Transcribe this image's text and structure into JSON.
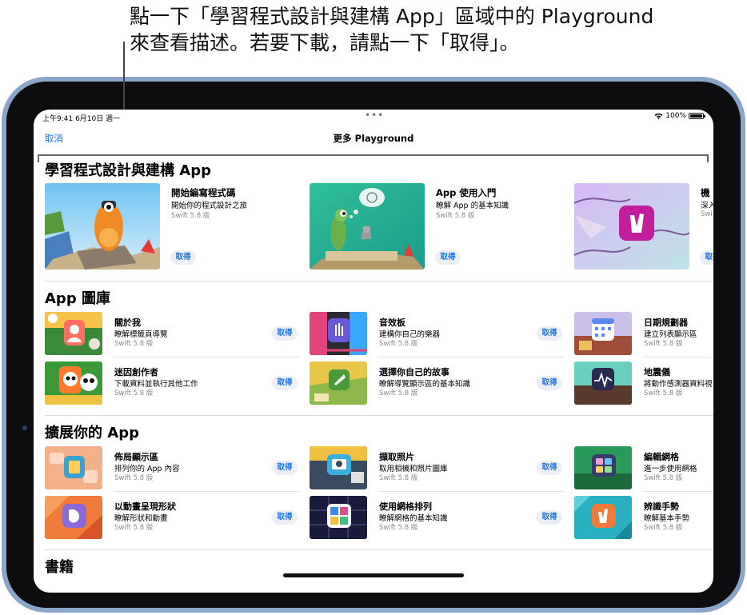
{
  "callout": {
    "line1": "點一下「學習程式設計與建構 App」區域中的 Playground",
    "line2": "來查看描述。若要下載，請點一下「取得」。"
  },
  "status": {
    "time": "上午9:41  6月10日 週一",
    "dots": "•••",
    "battery": "100%"
  },
  "nav": {
    "cancel": "取消",
    "title": "更多 Playground"
  },
  "get_label": "取得",
  "featured": {
    "title": "學習程式設計與建構 App",
    "items": [
      {
        "name": "開始編寫程式碼",
        "subtitle": "開始你的程式設計之旅",
        "version": "Swift 5.8 版",
        "icon": "orange-character-art"
      },
      {
        "name": "App 使用入門",
        "subtitle": "瞭解 App 的基本知識",
        "version": "Swift 5.8 版",
        "icon": "green-character-art"
      },
      {
        "name": "機",
        "subtitle": "深入",
        "version": "Swi",
        "icon": "hand-gesture-art"
      }
    ]
  },
  "gallery": {
    "title": "App 圖庫",
    "items": [
      {
        "name": "關於我",
        "subtitle": "瞭解標籤頁導覽",
        "version": "Swift 5.8 版",
        "icon": "about-me-art"
      },
      {
        "name": "音效板",
        "subtitle": "建構你自己的樂器",
        "version": "Swift 5.8 版",
        "icon": "soundboard-art"
      },
      {
        "name": "日期規劃器",
        "subtitle": "建立列表顯示區",
        "version": "Swift 5.8 版",
        "icon": "date-planner-art"
      },
      {
        "name": "迷因創作者",
        "subtitle": "下載資料並執行其他工作",
        "version": "Swift 5.8 版",
        "icon": "meme-creator-art"
      },
      {
        "name": "選擇你自己的故事",
        "subtitle": "瞭解導覽顯示區的基本知識",
        "version": "Swift 5.8 版",
        "icon": "story-art"
      },
      {
        "name": "地震儀",
        "subtitle": "將動作感測器資料視",
        "version": "Swift 5.8 版",
        "icon": "seismometer-art"
      }
    ]
  },
  "extend": {
    "title": "擴展你的 App",
    "items": [
      {
        "name": "佈局顯示區",
        "subtitle": "排列你的 App 內容",
        "version": "Swift 5.8 版",
        "icon": "layout-art"
      },
      {
        "name": "擷取照片",
        "subtitle": "取用相機和照片圖庫",
        "version": "Swift 5.8 版",
        "icon": "camera-art"
      },
      {
        "name": "編輯網格",
        "subtitle": "進一步使用網格",
        "version": "Swift 5.8 版",
        "icon": "edit-grid-art"
      },
      {
        "name": "以動畫呈現形狀",
        "subtitle": "瞭解形狀和動畫",
        "version": "Swift 5.8 版",
        "icon": "shapes-art"
      },
      {
        "name": "使用網格排列",
        "subtitle": "瞭解網格的基本知識",
        "version": "Swift 5.8 版",
        "icon": "grid-art"
      },
      {
        "name": "辨識手勢",
        "subtitle": "瞭解基本手勢",
        "version": "Swift 5.8 版",
        "icon": "gesture-art"
      }
    ]
  },
  "books": {
    "title": "書籍"
  },
  "colors": {
    "accent": "#1a73e8",
    "device": "#8aa5c9",
    "bezel": "#0d0d0f"
  }
}
